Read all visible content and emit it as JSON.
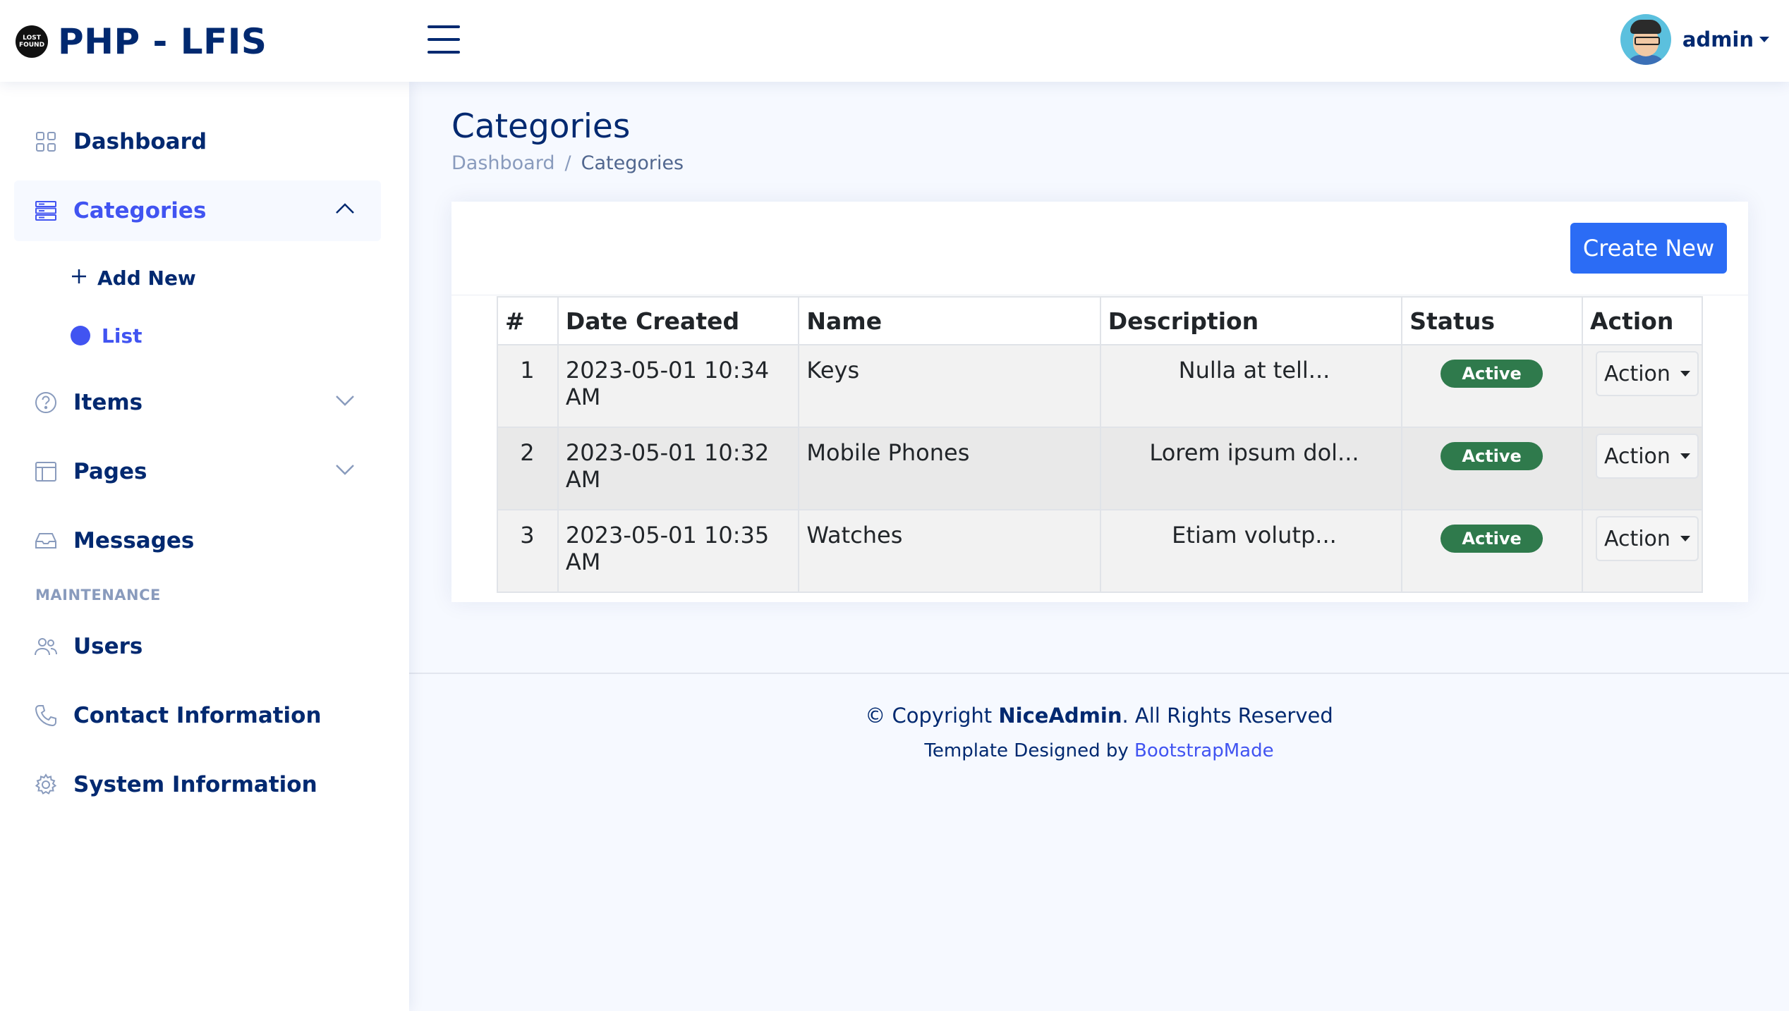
{
  "header": {
    "logo_badge": "LOST FOUND",
    "app_title": "PHP - LFIS",
    "user_name": "admin"
  },
  "sidebar": {
    "dashboard": "Dashboard",
    "categories": "Categories",
    "add_new": "Add New",
    "list": "List",
    "items": "Items",
    "pages": "Pages",
    "messages": "Messages",
    "heading_maintenance": "MAINTENANCE",
    "users": "Users",
    "contact": "Contact Information",
    "system": "System Information"
  },
  "main": {
    "title": "Categories",
    "breadcrumb": [
      "Dashboard",
      "Categories"
    ],
    "create_button": "Create New",
    "table": {
      "headers": [
        "#",
        "Date Created",
        "Name",
        "Description",
        "Status",
        "Action"
      ],
      "rows": [
        {
          "num": "1",
          "date": "2023-05-01 10:34 AM",
          "name": "Keys",
          "desc": "Nulla at tell...",
          "status": "Active",
          "action": "Action"
        },
        {
          "num": "2",
          "date": "2023-05-01 10:32 AM",
          "name": "Mobile Phones",
          "desc": "Lorem ipsum dol...",
          "status": "Active",
          "action": "Action"
        },
        {
          "num": "3",
          "date": "2023-05-01 10:35 AM",
          "name": "Watches",
          "desc": "Etiam volutp...",
          "status": "Active",
          "action": "Action"
        }
      ]
    }
  },
  "footer": {
    "copy_prefix": "© Copyright",
    "copy_brand": "NiceAdmin",
    "copy_suffix": ". All Rights Reserved",
    "designed_by": "Template Designed by",
    "designer": "BootstrapMade"
  },
  "colors": {
    "primary": "#4154f1",
    "navy": "#012970",
    "button": "#2b6cf5",
    "badge_active": "#2f7a4c"
  }
}
